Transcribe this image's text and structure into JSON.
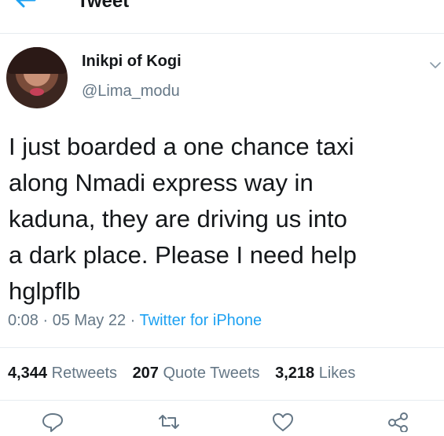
{
  "header": {
    "title": "Tweet"
  },
  "author": {
    "display_name": "Inikpi of Kogi",
    "username": "@Lima_modu"
  },
  "tweet": {
    "text": "I just boarded a one chance taxi\nalong Nmadi express way in\nkaduna, they are driving us into\na dark place. Please I need help\nhglpflb",
    "time": "0:08",
    "separator1": " · ",
    "date": "05 May 22",
    "separator2": " · ",
    "source": "Twitter for iPhone"
  },
  "stats": {
    "retweets_count": "4,344",
    "retweets_label": "Retweets",
    "quotes_count": "207",
    "quotes_label": "Quote Tweets",
    "likes_count": "3,218",
    "likes_label": "Likes"
  },
  "colors": {
    "accent": "#1da1f2",
    "secondary_text": "#657786",
    "divider": "#e6ecf0"
  },
  "icons": [
    "back-arrow-icon",
    "chevron-down-icon",
    "reply-icon",
    "retweet-icon",
    "like-icon",
    "share-icon"
  ]
}
